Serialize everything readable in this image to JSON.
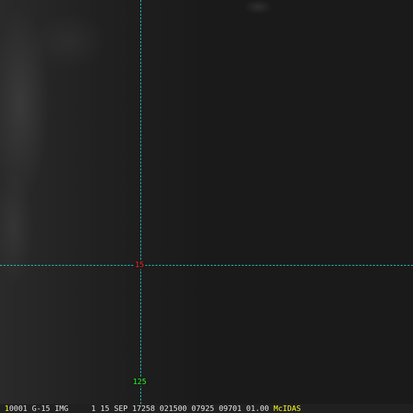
{
  "image": {
    "satellite_imagery": "dark IR/visible satellite view with faint clouds on left"
  },
  "grid": {
    "latitude_label": "15",
    "longitude_label": "125",
    "line_color": "#22dddd"
  },
  "footer": {
    "frame": "1",
    "info": "0001 G-15 IMG     1 15 SEP 17258 021500 07925 09701 01.00",
    "brand": "McIDAS"
  }
}
